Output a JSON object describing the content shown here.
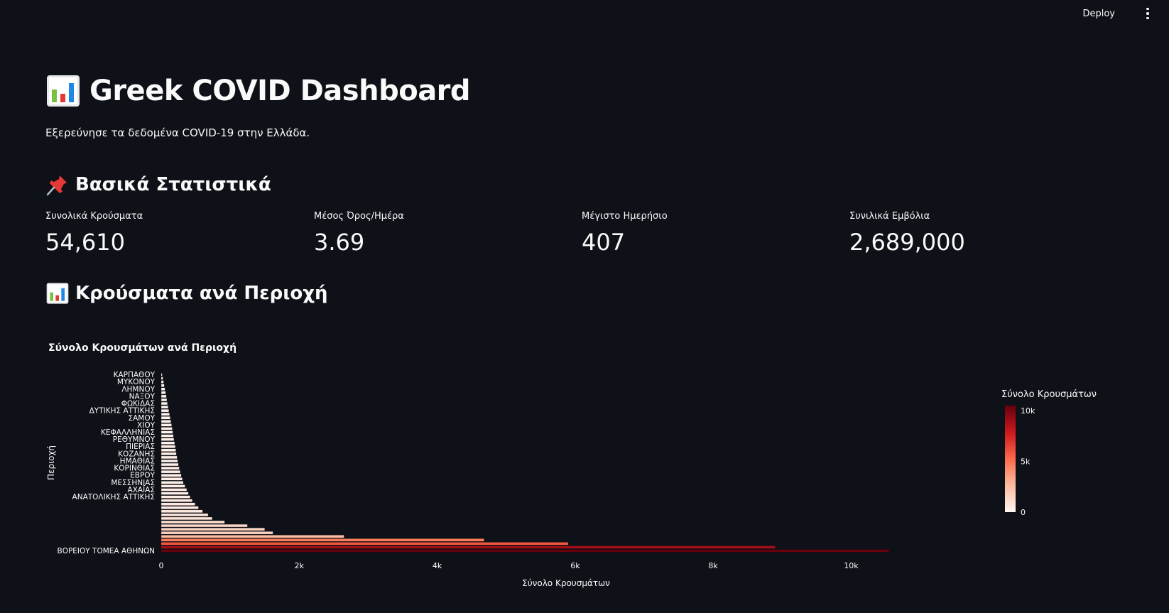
{
  "toolbar": {
    "deploy_label": "Deploy",
    "menu_icon": "kebab-menu-icon"
  },
  "header": {
    "title": "Greek COVID Dashboard",
    "title_icon": "bar-chart-icon",
    "subtitle": "Εξερεύνησε τα δεδομένα COVID-19 στην Ελλάδα."
  },
  "stats_section": {
    "heading": "Βασικά Στατιστικά",
    "icon": "pushpin-icon",
    "metrics": [
      {
        "label": "Συνολικά Κρούσματα",
        "value": "54,610"
      },
      {
        "label": "Μέσος Όρος/Ημέρα",
        "value": "3.69"
      },
      {
        "label": "Μέγιστο Ημερήσιο",
        "value": "407"
      },
      {
        "label": "Συνιλικά Εμβόλια",
        "value": "2,689,000"
      }
    ]
  },
  "region_section": {
    "heading": "Κρούσματα ανά Περιοχή",
    "icon": "bar-chart-icon"
  },
  "chart_data": {
    "type": "bar",
    "orientation": "horizontal",
    "title": "Σύνολο Κρουσμάτων ανά Περιοχή",
    "xlabel": "Σύνολο Κρουσμάτων",
    "ylabel": "Περιοχή",
    "xlim": [
      0,
      10500
    ],
    "xticks": [
      0,
      2000,
      4000,
      6000,
      8000,
      10000
    ],
    "xtick_labels": [
      "0",
      "2k",
      "4k",
      "6k",
      "8k",
      "10k"
    ],
    "ytick_labels": [
      "ΚΑΡΠΑΘΟΥ",
      "ΜΥΚΟΝΟΥ",
      "ΛΗΜΝΟΥ",
      "ΝΑΞΟΥ",
      "ΦΩΚΙΔΑΣ",
      "ΔΥΤΙΚΗΣ ΑΤΤΙΚΗΣ",
      "ΣΑΜΟΥ",
      "ΧΙΟΥ",
      "ΚΕΦΑΛΛΗΝΙΑΣ",
      "ΡΕΘΥΜΝΟΥ",
      "ΠΙΕΡΙΑΣ",
      "ΚΟΖΑΝΗΣ",
      "ΗΜΑΘΙΑΣ",
      "ΚΟΡΙΝΘΙΑΣ",
      "ΕΒΡΟΥ",
      "ΜΕΣΣΗΝΙΑΣ",
      "ΑΧΑΪΑΣ",
      "ΑΝΑΤΟΛΙΚΗΣ ΑΤΤΙΚΗΣ",
      "ΒΟΡΕΙΟΥ ΤΟΜΕΑ ΑΘΗΝΩΝ"
    ],
    "values": [
      15,
      25,
      35,
      45,
      55,
      65,
      75,
      82,
      90,
      100,
      110,
      120,
      130,
      140,
      150,
      160,
      168,
      176,
      185,
      195,
      205,
      212,
      220,
      230,
      240,
      250,
      262,
      275,
      290,
      305,
      320,
      345,
      370,
      395,
      420,
      450,
      490,
      540,
      600,
      680,
      740,
      920,
      1250,
      1500,
      1620,
      2650,
      4680,
      5900,
      8900,
      10550
    ],
    "colorscale": [
      "#fff5f0",
      "#fcbba1",
      "#fb6a4a",
      "#cb181d",
      "#67000d"
    ],
    "colorbar": {
      "title": "Σύνολο Κρουσμάτων",
      "range": [
        0,
        10500
      ],
      "ticks": [
        0,
        5000,
        10000
      ],
      "tick_labels": [
        "0",
        "5k",
        "10k"
      ]
    },
    "grid": false
  }
}
